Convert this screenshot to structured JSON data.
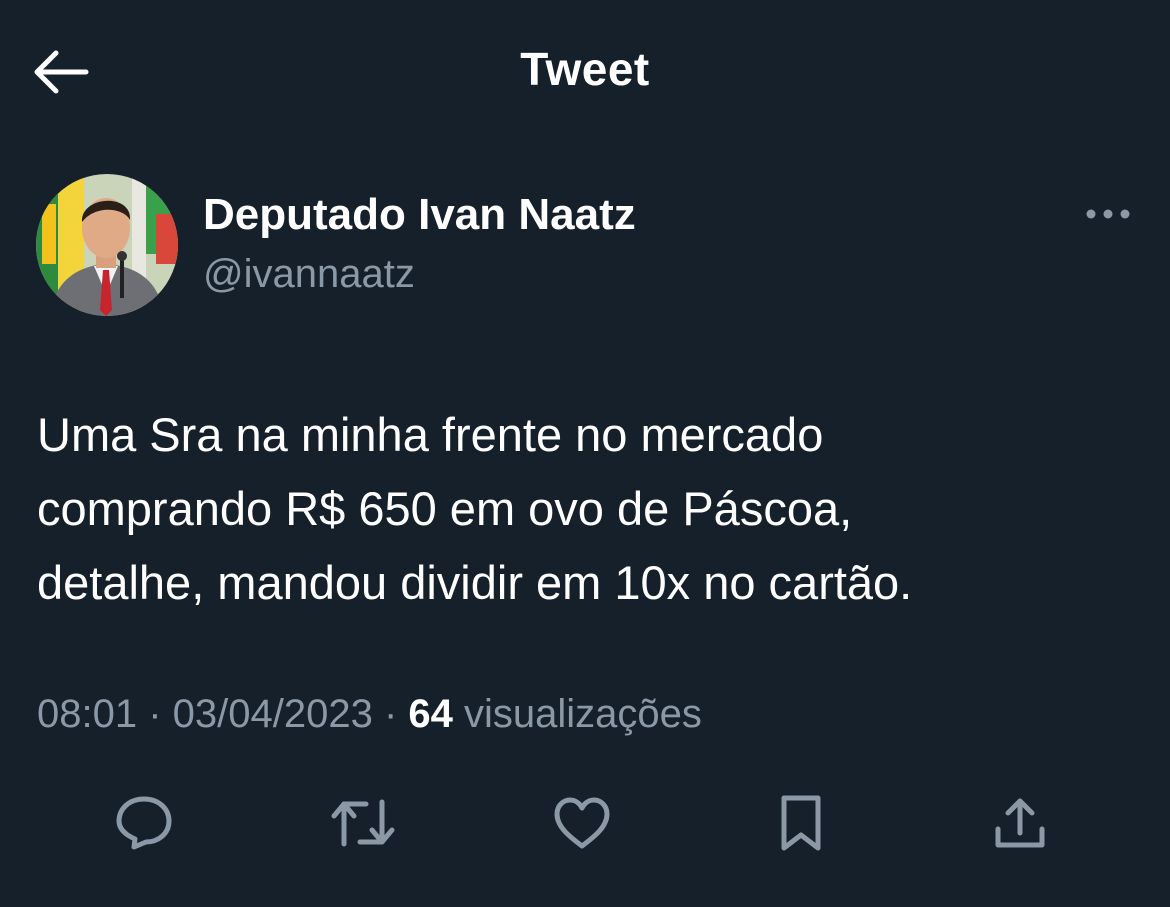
{
  "header": {
    "title": "Tweet"
  },
  "icons": {
    "back": "arrow-left-icon",
    "more": "more-horizontal-icon",
    "reply": "reply-icon",
    "retweet": "retweet-icon",
    "like": "heart-icon",
    "bookmark": "bookmark-icon",
    "share": "share-icon"
  },
  "author": {
    "display_name": "Deputado Ivan Naatz",
    "handle": "@ivannaatz"
  },
  "tweet": {
    "lines": [
      "Uma Sra na minha frente no mercado",
      "comprando R$ 650 em ovo de Páscoa,",
      "detalhe, mandou dividir em 10x no cartão."
    ]
  },
  "meta": {
    "time": "08:01",
    "separator": " · ",
    "date": "03/04/2023",
    "views_count": "64",
    "views_label": "visualizações"
  },
  "colors": {
    "background": "#15202b",
    "text_primary": "#ffffff",
    "text_secondary": "#8b98a5"
  }
}
